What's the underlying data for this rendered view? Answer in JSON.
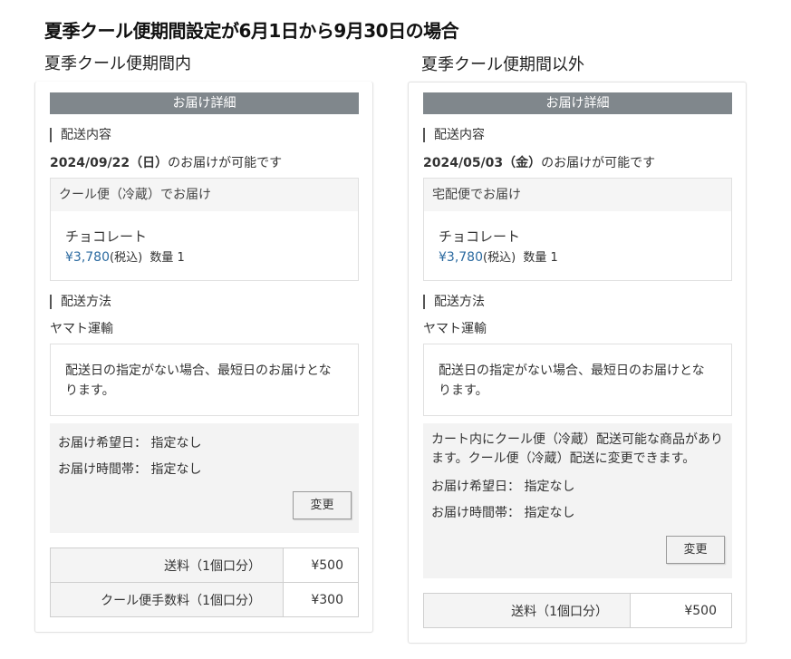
{
  "page": {
    "title": "夏季クール便期間設定が6月1日から9月30日の場合"
  },
  "left": {
    "subtitle": "夏季クール便期間内",
    "header": "お届け詳細",
    "delivery_content_label": "配送内容",
    "date": "2024/09/22（日）",
    "date_suffix": "のお届けが可能です",
    "box_head": "クール便（冷蔵）でお届け",
    "product_name": "チョコレート",
    "price": "¥3,780",
    "tax": "(税込)",
    "qty": "数量 1",
    "method_label": "配送方法",
    "carrier": "ヤマト運輸",
    "note_line1": "配送日の指定がない場合、最短日のお届けとな",
    "note_line2": "ります。",
    "wish_date": "お届け希望日： 指定なし",
    "wish_time": "お届け時間帯： 指定なし",
    "change_button": "変更",
    "fees": [
      {
        "label": "送料（1個口分）",
        "value": "¥500"
      },
      {
        "label": "クール便手数料（1個口分）",
        "value": "¥300"
      }
    ]
  },
  "right": {
    "subtitle": "夏季クール便期間以外",
    "header": "お届け詳細",
    "delivery_content_label": "配送内容",
    "date": "2024/05/03（金）",
    "date_suffix": "のお届けが可能です",
    "box_head": "宅配便でお届け",
    "product_name": "チョコレート",
    "price": "¥3,780",
    "tax": "(税込)",
    "qty": "数量 1",
    "method_label": "配送方法",
    "carrier": "ヤマト運輸",
    "note_line1": "配送日の指定がない場合、最短日のお届けとな",
    "note_line2": "ります。",
    "cool_notice_line1": "カート内にクール便（冷蔵）配送可能な商品があり",
    "cool_notice_line2": "ます。クール便（冷蔵）配送に変更できます。",
    "wish_date": "お届け希望日： 指定なし",
    "wish_time": "お届け時間帯： 指定なし",
    "change_button": "変更",
    "fees": [
      {
        "label": "送料（1個口分）",
        "value": "¥500"
      }
    ]
  }
}
